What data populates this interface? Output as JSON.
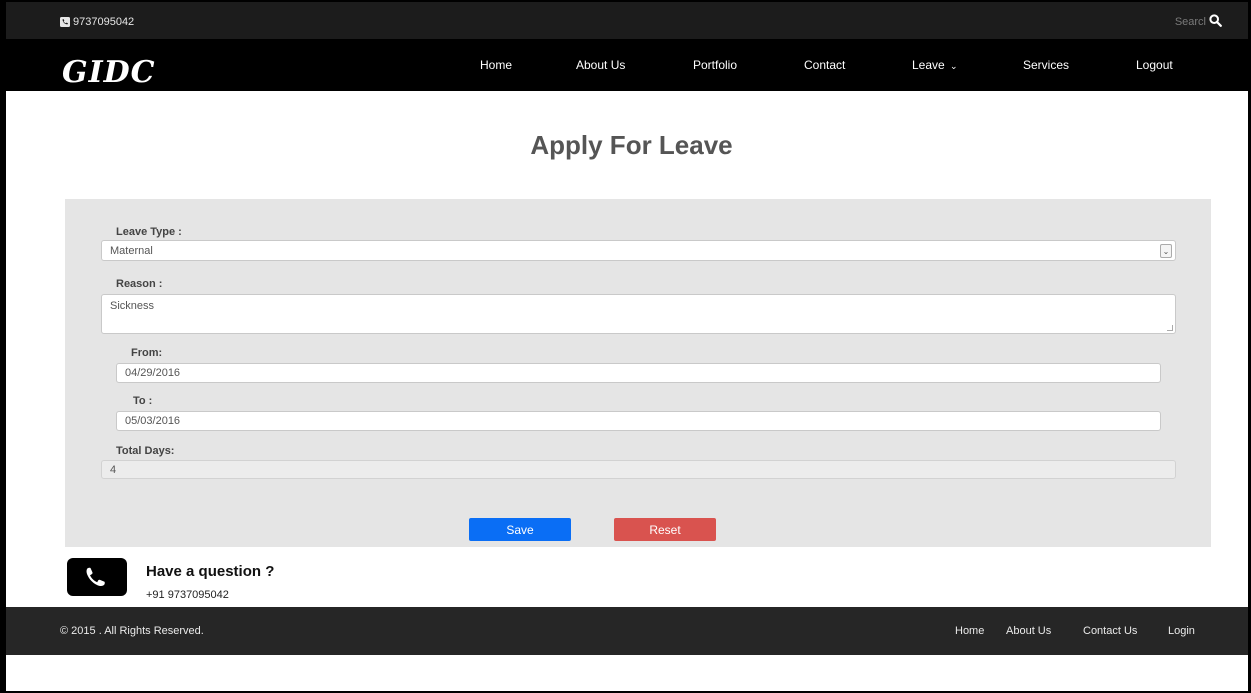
{
  "topbar": {
    "phone": "9737095042",
    "search_placeholder": "Searcl"
  },
  "header": {
    "logo": "GIDC",
    "nav": {
      "home": "Home",
      "about": "About Us",
      "portfolio": "Portfolio",
      "contact": "Contact",
      "leave": "Leave",
      "services": "Services",
      "logout": "Logout"
    }
  },
  "page": {
    "title": "Apply For Leave"
  },
  "form": {
    "leave_type_label": "Leave Type :",
    "leave_type_value": "Maternal",
    "reason_label": "Reason :",
    "reason_value": "Sickness",
    "from_label": "From:",
    "from_value": "04/29/2016",
    "to_label": "To :",
    "to_value": "05/03/2016",
    "total_days_label": "Total Days:",
    "total_days_value": "4",
    "save_label": "Save",
    "reset_label": "Reset"
  },
  "contact": {
    "question": "Have a question ?",
    "phone": "+91 9737095042"
  },
  "footer": {
    "copyright": "© 2015 . All Rights Reserved.",
    "links": {
      "home": "Home",
      "about": "About Us",
      "contact": "Contact Us",
      "login": "Login"
    }
  },
  "colors": {
    "save": "#0a6ef5",
    "reset": "#d9534f",
    "navbar": "#000000",
    "panel": "#e5e5e5"
  }
}
